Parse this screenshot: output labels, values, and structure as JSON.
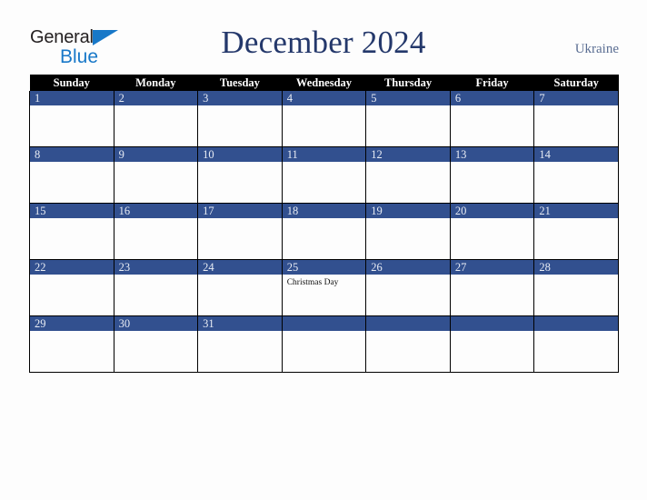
{
  "logo": {
    "word1": "General",
    "word2": "Blue",
    "triangle_color": "#1878c8",
    "text_color": "#231f20"
  },
  "header": {
    "title": "December 2024",
    "title_color": "#24386b",
    "country": "Ukraine",
    "country_color": "#5a6d92"
  },
  "calendar": {
    "header_bg": "#000000",
    "header_fg": "#ffffff",
    "daybar_bg": "#32508f",
    "daybar_fg": "#e8ecf4",
    "weekday_headers": [
      "Sunday",
      "Monday",
      "Tuesday",
      "Wednesday",
      "Thursday",
      "Friday",
      "Saturday"
    ],
    "weeks": [
      [
        {
          "day": "1",
          "events": []
        },
        {
          "day": "2",
          "events": []
        },
        {
          "day": "3",
          "events": []
        },
        {
          "day": "4",
          "events": []
        },
        {
          "day": "5",
          "events": []
        },
        {
          "day": "6",
          "events": []
        },
        {
          "day": "7",
          "events": []
        }
      ],
      [
        {
          "day": "8",
          "events": []
        },
        {
          "day": "9",
          "events": []
        },
        {
          "day": "10",
          "events": []
        },
        {
          "day": "11",
          "events": []
        },
        {
          "day": "12",
          "events": []
        },
        {
          "day": "13",
          "events": []
        },
        {
          "day": "14",
          "events": []
        }
      ],
      [
        {
          "day": "15",
          "events": []
        },
        {
          "day": "16",
          "events": []
        },
        {
          "day": "17",
          "events": []
        },
        {
          "day": "18",
          "events": []
        },
        {
          "day": "19",
          "events": []
        },
        {
          "day": "20",
          "events": []
        },
        {
          "day": "21",
          "events": []
        }
      ],
      [
        {
          "day": "22",
          "events": []
        },
        {
          "day": "23",
          "events": []
        },
        {
          "day": "24",
          "events": []
        },
        {
          "day": "25",
          "events": [
            "Christmas Day"
          ]
        },
        {
          "day": "26",
          "events": []
        },
        {
          "day": "27",
          "events": []
        },
        {
          "day": "28",
          "events": []
        }
      ],
      [
        {
          "day": "29",
          "events": []
        },
        {
          "day": "30",
          "events": []
        },
        {
          "day": "31",
          "events": []
        },
        {
          "day": "",
          "events": []
        },
        {
          "day": "",
          "events": []
        },
        {
          "day": "",
          "events": []
        },
        {
          "day": "",
          "events": []
        }
      ]
    ]
  }
}
